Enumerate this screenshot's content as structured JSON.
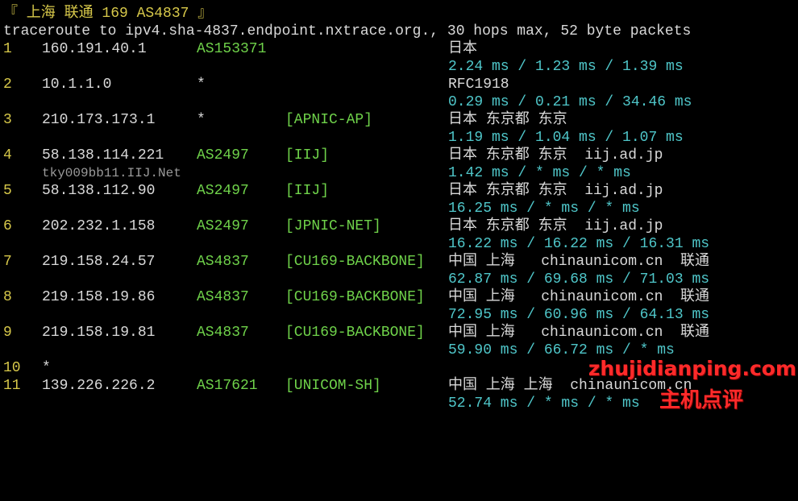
{
  "header": {
    "title": "『 上海 联通 169 AS4837 』",
    "command": "traceroute to ipv4.sha-4837.endpoint.nxtrace.org., 30 hops max, 52 byte packets"
  },
  "hops": [
    {
      "num": "1",
      "ip": "160.191.40.1",
      "asn": "AS153371",
      "net": "",
      "geo": "日本",
      "rtt": "2.24 ms / 1.23 ms / 1.39 ms"
    },
    {
      "num": "2",
      "ip": "10.1.1.0",
      "asn": "*",
      "net": "",
      "geo": "RFC1918",
      "rtt": "0.29 ms / 0.21 ms / 34.46 ms"
    },
    {
      "num": "3",
      "ip": "210.173.173.1",
      "asn": "*",
      "net": "[APNIC-AP]",
      "geo": "日本 东京都 东京",
      "rtt": "1.19 ms / 1.04 ms / 1.07 ms"
    },
    {
      "num": "4",
      "ip": "58.138.114.221",
      "asn": "AS2497",
      "net": "[IIJ]",
      "geo": "日本 东京都 东京  iij.ad.jp",
      "rdns": "tky009bb11.IIJ.Net",
      "rtt": "1.42 ms / * ms / * ms"
    },
    {
      "num": "5",
      "ip": "58.138.112.90",
      "asn": "AS2497",
      "net": "[IIJ]",
      "geo": "日本 东京都 东京  iij.ad.jp",
      "rtt": "16.25 ms / * ms / * ms"
    },
    {
      "num": "6",
      "ip": "202.232.1.158",
      "asn": "AS2497",
      "net": "[JPNIC-NET]",
      "geo": "日本 东京都 东京  iij.ad.jp",
      "rtt": "16.22 ms / 16.22 ms / 16.31 ms"
    },
    {
      "num": "7",
      "ip": "219.158.24.57",
      "asn": "AS4837",
      "net": "[CU169-BACKBONE]",
      "geo": "中国 上海   chinaunicom.cn  联通",
      "rtt": "62.87 ms / 69.68 ms / 71.03 ms"
    },
    {
      "num": "8",
      "ip": "219.158.19.86",
      "asn": "AS4837",
      "net": "[CU169-BACKBONE]",
      "geo": "中国 上海   chinaunicom.cn  联通",
      "rtt": "72.95 ms / 60.96 ms / 64.13 ms"
    },
    {
      "num": "9",
      "ip": "219.158.19.81",
      "asn": "AS4837",
      "net": "[CU169-BACKBONE]",
      "geo": "中国 上海   chinaunicom.cn  联通",
      "rtt": "59.90 ms / 66.72 ms / * ms"
    },
    {
      "num": "10",
      "ip": "*"
    },
    {
      "num": "11",
      "ip": "139.226.226.2",
      "asn": "AS17621",
      "net": "[UNICOM-SH]",
      "geo": "中国 上海 上海  chinaunicom.cn",
      "rtt": "52.74 ms / * ms / * ms"
    }
  ],
  "watermark": {
    "site": "zhujidianping.com",
    "brand": "主机点评"
  },
  "colors": {
    "background": "#000000",
    "text": "#d9d9d9",
    "hop_number": "#d7c84a",
    "asn": "#6fd24a",
    "rtt": "#4fc6c9",
    "watermark": "#ff2a2a"
  }
}
